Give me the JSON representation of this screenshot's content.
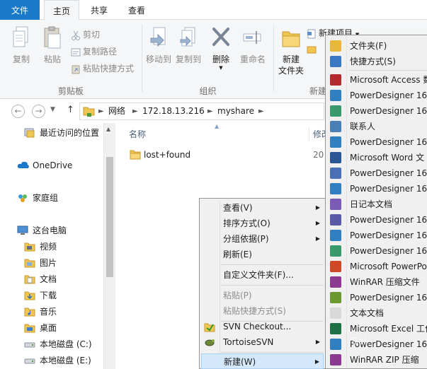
{
  "tabs": {
    "file": "文件",
    "home": "主页",
    "share": "共享",
    "view": "查看"
  },
  "ribbon": {
    "clipboard": {
      "label": "剪贴板",
      "copy": "复制",
      "paste": "粘贴",
      "cut": "剪切",
      "copy_path": "复制路径",
      "paste_shortcut": "粘贴快捷方式"
    },
    "organize": {
      "label": "组织",
      "move_to": "移动到",
      "copy_to": "复制到",
      "delete": "删除",
      "rename": "重命名"
    },
    "new": {
      "label": "新建",
      "new_item": "新建项目",
      "new_folder_line1": "新建",
      "new_folder_line2": "文件夹"
    }
  },
  "address": {
    "back": "←",
    "forward": "→",
    "up": "↑",
    "crumbs": [
      "网络",
      "172.18.13.216",
      "myshare"
    ]
  },
  "navpane": {
    "recent": "最近访问的位置",
    "onedrive": "OneDrive",
    "homegroup": "家庭组",
    "this_pc": "这台电脑",
    "videos": "视频",
    "pictures": "图片",
    "documents": "文档",
    "downloads": "下载",
    "music": "音乐",
    "desktop": "桌面",
    "local_disk_c": "本地磁盘 (C:)",
    "local_disk_e": "本地磁盘 (E:)"
  },
  "filelist": {
    "col_name": "名称",
    "col_date": "修改",
    "files": [
      {
        "name": "lost+found",
        "date": "20"
      }
    ]
  },
  "context_menu": {
    "view": "查看(V)",
    "sort_by": "排序方式(O)",
    "group_by": "分组依据(P)",
    "refresh": "刷新(E)",
    "customize": "自定义文件夹(F)...",
    "paste": "粘贴(P)",
    "paste_shortcut": "粘贴快捷方式(S)",
    "svn_checkout": "SVN Checkout...",
    "tortoise_svn": "TortoiseSVN",
    "new": "新建(W)"
  },
  "new_submenu": {
    "items": [
      {
        "label": "文件夹(F)",
        "icon": "folder-icon",
        "color": "#e8b838"
      },
      {
        "label": "快捷方式(S)",
        "icon": "shortcut-icon",
        "color": "#3b78c4"
      },
      {
        "label": "Microsoft Access 数",
        "icon": "access-icon",
        "color": "#b7282e"
      },
      {
        "label": "PowerDesigner 16",
        "icon": "powerdesigner-icon",
        "color": "#2f7fc1"
      },
      {
        "label": "PowerDesigner 16",
        "icon": "powerdesigner-icon",
        "color": "#3a9a6b"
      },
      {
        "label": "联系人",
        "icon": "contact-icon",
        "color": "#4a7fb5"
      },
      {
        "label": "PowerDesigner 16",
        "icon": "powerdesigner-icon",
        "color": "#2f7fc1"
      },
      {
        "label": "Microsoft Word 文",
        "icon": "word-icon",
        "color": "#2b5797"
      },
      {
        "label": "PowerDesigner 16",
        "icon": "powerdesigner-icon",
        "color": "#4b6fb5"
      },
      {
        "label": "PowerDesigner 16",
        "icon": "powerdesigner-icon",
        "color": "#2f7fc1"
      },
      {
        "label": "日记本文档",
        "icon": "journal-icon",
        "color": "#7a5bb5"
      },
      {
        "label": "PowerDesigner 16",
        "icon": "powerdesigner-icon",
        "color": "#5a5aa8"
      },
      {
        "label": "PowerDesigner 16",
        "icon": "powerdesigner-icon",
        "color": "#2f7fc1"
      },
      {
        "label": "PowerDesigner 16",
        "icon": "powerdesigner-icon",
        "color": "#3a9a6b"
      },
      {
        "label": "Microsoft PowerPo",
        "icon": "powerpoint-icon",
        "color": "#d24726"
      },
      {
        "label": "WinRAR 压缩文件",
        "icon": "winrar-icon",
        "color": "#8b3a8f"
      },
      {
        "label": "PowerDesigner 16",
        "icon": "powerdesigner-icon",
        "color": "#6a9a2f"
      },
      {
        "label": "文本文档",
        "icon": "text-document-icon",
        "color": "#d9d9d9"
      },
      {
        "label": "Microsoft Excel 工作",
        "icon": "excel-icon",
        "color": "#1e7145"
      },
      {
        "label": "PowerDesigner 16",
        "icon": "powerdesigner-icon",
        "color": "#2f7fc1"
      },
      {
        "label": "WinRAR ZIP 压缩",
        "icon": "winrar-zip-icon",
        "color": "#8b3a8f"
      }
    ]
  },
  "colors": {
    "accent": "#1979ca",
    "highlight": "#d5e8fb",
    "folder": "#e8b838"
  }
}
